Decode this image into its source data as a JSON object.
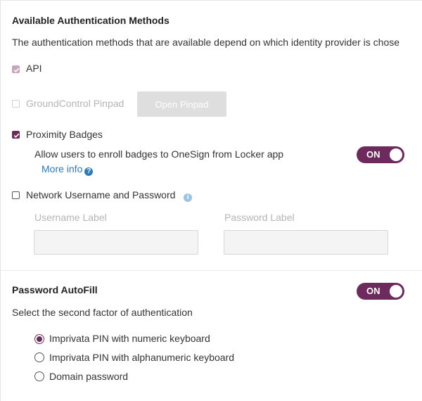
{
  "auth": {
    "heading": "Available Authentication Methods",
    "description": "The authentication methods that are available depend on which identity provider is chose",
    "methods": {
      "api": {
        "label": "API",
        "checked": true,
        "disabled": false
      },
      "pinpad": {
        "label": "GroundControl Pinpad",
        "checked": false,
        "disabled": true,
        "button": "Open Pinpad"
      },
      "badges": {
        "label": "Proximity Badges",
        "checked": true,
        "enroll_text": "Allow users to enroll badges to OneSign from Locker app",
        "toggle": "ON",
        "more_info": "More info"
      },
      "network": {
        "label": "Network Username and Password",
        "checked": false,
        "username_label": "Username Label",
        "password_label": "Password Label",
        "username_value": "",
        "password_value": ""
      }
    }
  },
  "autofill": {
    "heading": "Password AutoFill",
    "toggle": "ON",
    "prompt": "Select the second factor of authentication",
    "options": [
      {
        "label": "Imprivata PIN with numeric keyboard",
        "selected": true
      },
      {
        "label": "Imprivata PIN with alphanumeric keyboard",
        "selected": false
      },
      {
        "label": "Domain password",
        "selected": false
      }
    ]
  },
  "colors": {
    "accent": "#6d2a5c",
    "link": "#2b7bb9",
    "disabled": "#b5b5b5"
  },
  "icons": {
    "info": "info-circle-icon",
    "help": "question-circle-icon",
    "check": "checkmark-icon"
  }
}
